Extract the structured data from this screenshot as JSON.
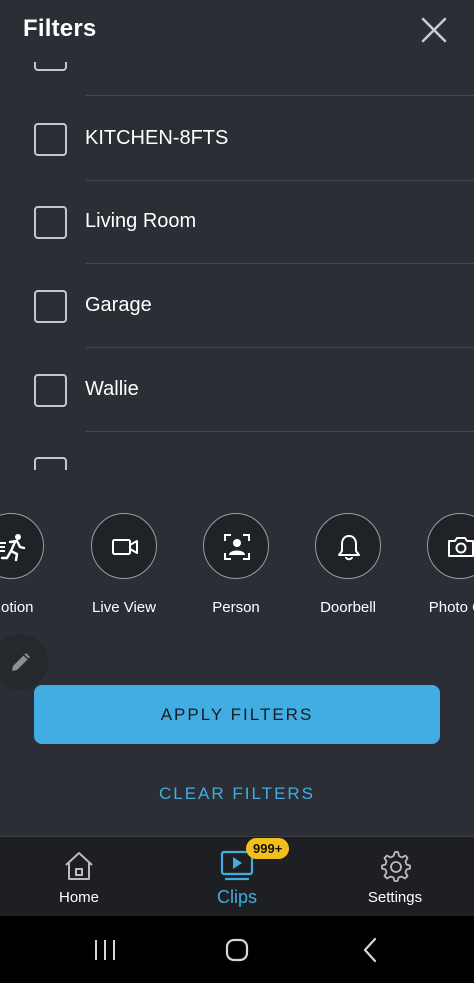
{
  "header": {
    "title": "Filters"
  },
  "cameras": {
    "items": [
      {
        "label": ""
      },
      {
        "label": "KITCHEN-8FTS"
      },
      {
        "label": "Living Room"
      },
      {
        "label": "Garage"
      },
      {
        "label": "Wallie"
      },
      {
        "label": ""
      }
    ]
  },
  "event_types": {
    "items": [
      {
        "label": "Motion",
        "icon": "motion-icon"
      },
      {
        "label": "Live View",
        "icon": "video-camera-icon"
      },
      {
        "label": "Person",
        "icon": "person-icon"
      },
      {
        "label": "Doorbell",
        "icon": "bell-icon"
      },
      {
        "label": "Photo Ca",
        "icon": "photo-camera-icon"
      }
    ]
  },
  "actions": {
    "apply_label": "APPLY FILTERS",
    "clear_label": "CLEAR FILTERS"
  },
  "nav": {
    "items": [
      {
        "label": "Home",
        "icon": "home-icon"
      },
      {
        "label": "Clips",
        "icon": "clips-icon",
        "active": true,
        "badge": "999+"
      },
      {
        "label": "Settings",
        "icon": "gear-icon"
      }
    ]
  },
  "colors": {
    "background": "#2b2e34",
    "accent": "#41ade2",
    "badge": "#f2c01e",
    "nav_background": "#1e1f22"
  }
}
